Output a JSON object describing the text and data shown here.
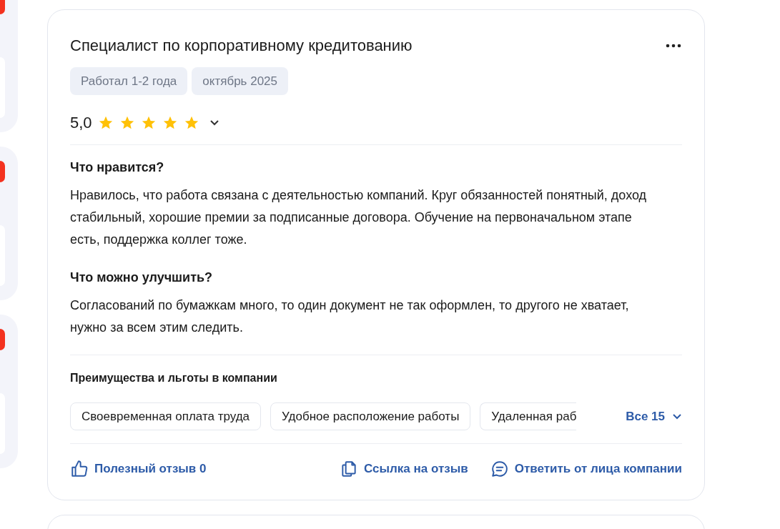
{
  "review": {
    "title": "Специалист по корпоративному кредитованию",
    "tags": [
      "Работал 1-2 года",
      "октябрь 2025"
    ],
    "rating": "5,0",
    "stars": 5,
    "sections": [
      {
        "heading": "Что нравится?",
        "text": "Нравилось, что работа связана с деятельностью компаний. Круг обязанностей понятный, доход стабильный, хорошие премии за подписанные договора. Обучение на первоначальном этапе есть, поддержка коллег тоже."
      },
      {
        "heading": "Что можно улучшить?",
        "text": "Согласований по бумажкам много, то один документ не так оформлен, то другого не хватает, нужно за всем этим следить."
      }
    ],
    "benefits": {
      "title": "Преимущества и льготы в компании",
      "items": [
        "Своевременная оплата труда",
        "Удобное расположение работы",
        "Удаленная раб"
      ],
      "more": "Все 15"
    },
    "actions": [
      {
        "kind": "like",
        "label": "Полезный отзыв 0"
      },
      {
        "kind": "link",
        "label": "Ссылка на отзыв"
      },
      {
        "kind": "reply",
        "label": "Ответить от лица компании"
      }
    ]
  }
}
